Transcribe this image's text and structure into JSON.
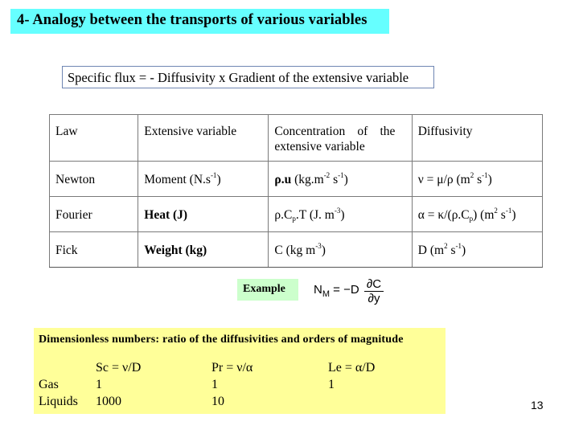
{
  "slide": {
    "title": "4- Analogy between the transports of various variables",
    "flux_statement": "Specific flux = - Diffusivity x Gradient of the extensive variable",
    "page_number": "13",
    "colors": {
      "title_bg": "#66ffff",
      "flux_border": "#6f86b3",
      "example_bg": "#ccffcc",
      "dimensionless_bg": "#ffff99"
    }
  },
  "table": {
    "headers": {
      "law": "Law",
      "extensive": "Extensive variable",
      "concentration_line1_a": "Concentration",
      "concentration_line1_b": "of",
      "concentration_line1_c": "the",
      "concentration_line2": "extensive variable",
      "diffusivity": "Diffusivity"
    },
    "rows": [
      {
        "law": "Newton",
        "extensive": "Moment (N.s",
        "extensive_sup": "-1",
        "extensive_end": ")",
        "conc_a": "ρ.u",
        "conc_b": " (kg.m",
        "conc_sup1": "-2",
        "conc_c": " s",
        "conc_sup2": "-1",
        "conc_end": ")",
        "diff_a": "ν = μ/ρ (m",
        "diff_sup1": "2",
        "diff_b": " s",
        "diff_sup2": "-1",
        "diff_end": ")"
      },
      {
        "law": "Fourier",
        "extensive": "Heat  (J)",
        "conc_a": "ρ.C",
        "conc_sub": "p",
        "conc_b": ".T  (J. m",
        "conc_sup1": "-3",
        "conc_end": ")",
        "diff_a": "α = κ/(ρ.C",
        "diff_sub": "p",
        "diff_b": ")  (m",
        "diff_sup1": "2",
        "diff_c": " s",
        "diff_sup2": "-1",
        "diff_end": ")"
      },
      {
        "law": "Fick",
        "extensive": "Weight (kg)",
        "conc_a": "C  (kg m",
        "conc_sup1": "-3",
        "conc_end": ")",
        "diff_a": "D (m",
        "diff_sup1": "2",
        "diff_b": " s",
        "diff_sup2": "-1",
        "diff_end": ")"
      }
    ]
  },
  "example": {
    "label": "Example",
    "equation_lhs": "N",
    "equation_lhs_sub": "M",
    "equation_mid": " = −D",
    "equation_num": "∂C",
    "equation_den": "∂y"
  },
  "dimensionless": {
    "title": "Dimensionless numbers: ratio of the diffusivities and orders of magnitude",
    "header": [
      "",
      "Sc = ν/D",
      "Pr = ν/α",
      "Le = α/D"
    ],
    "rows": [
      [
        "Gas",
        "1",
        "1",
        "1"
      ],
      [
        "Liquids",
        "1000",
        "10",
        ""
      ]
    ]
  }
}
